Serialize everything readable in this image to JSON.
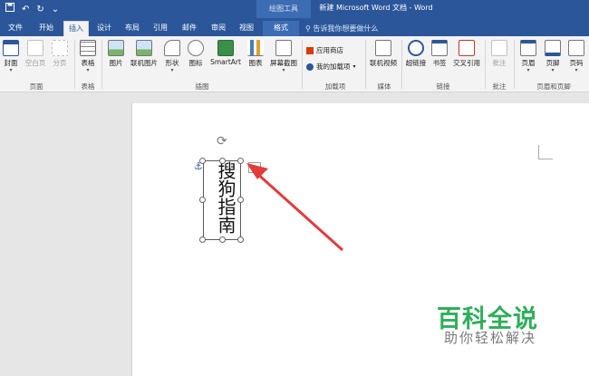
{
  "titlebar": {
    "save_icon": "save-icon",
    "undo_icon": "undo-icon",
    "redo_icon": "redo-icon",
    "customize_icon": "customize-qat-icon",
    "context_title": "绘图工具",
    "document_title": "新建 Microsoft Word 文档 - Word"
  },
  "tabs": [
    {
      "label": "文件"
    },
    {
      "label": "开始"
    },
    {
      "label": "插入"
    },
    {
      "label": "设计"
    },
    {
      "label": "布局"
    },
    {
      "label": "引用"
    },
    {
      "label": "邮件"
    },
    {
      "label": "审阅"
    },
    {
      "label": "视图"
    },
    {
      "label": "格式"
    }
  ],
  "tellme": "告诉我你想要做什么",
  "ribbon": {
    "pages": {
      "cover": "封面",
      "blank": "空白页",
      "break": "分页",
      "label": "页面"
    },
    "tables": {
      "table": "表格",
      "label": "表格"
    },
    "illustrations": {
      "picture": "图片",
      "online_picture": "联机图片",
      "shapes": "形状",
      "icons": "图标",
      "smartart": "SmartArt",
      "chart": "图表",
      "screenshot": "屏幕截图",
      "label": "插图"
    },
    "addins": {
      "store": "应用商店",
      "my_addins": "我的加载项",
      "label": "加载项"
    },
    "media": {
      "online_video": "联机视频",
      "label": "媒体"
    },
    "links": {
      "hyperlink": "超链接",
      "bookmark": "书签",
      "cross_ref": "交叉引用",
      "label": "链接"
    },
    "comments": {
      "comment": "批注",
      "label": "批注"
    },
    "header_footer": {
      "header": "页眉",
      "footer": "页脚",
      "page_number": "页码",
      "label": "页眉和页脚"
    }
  },
  "document": {
    "textbox_text": "搜狗指南"
  },
  "watermark": {
    "title": "百科全说",
    "subtitle": "助你轻松解决"
  },
  "colors": {
    "accent": "#2b579a",
    "arrow": "#e03c3c",
    "watermark": "#2fae5a"
  }
}
